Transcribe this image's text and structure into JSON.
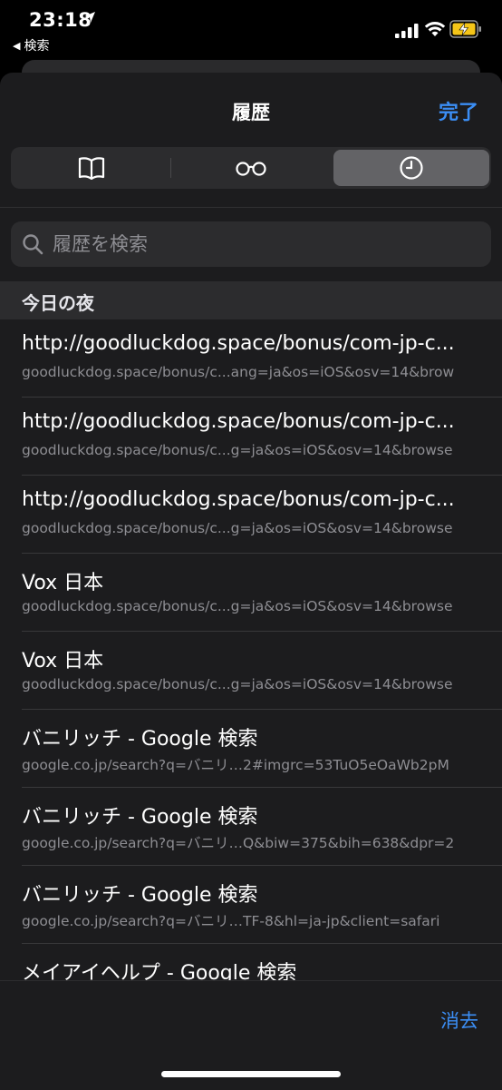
{
  "status": {
    "time": "23:18",
    "back_app": "検索"
  },
  "sheet": {
    "title": "履歴",
    "done_label": "完了",
    "tabs": [
      {
        "icon": "book-icon",
        "selected": false
      },
      {
        "icon": "reading-list-glasses-icon",
        "selected": false
      },
      {
        "icon": "history-clock-icon",
        "selected": true
      }
    ],
    "search_placeholder": "履歴を検索",
    "section_title": "今日の夜",
    "clear_label": "消去"
  },
  "history": [
    {
      "title": "http://goodluckdog.space/bonus/com-jp-c...",
      "url": "goodluckdog.space/bonus/c...ang=ja&os=iOS&osv=14&brow"
    },
    {
      "title": "http://goodluckdog.space/bonus/com-jp-c...",
      "url": "goodluckdog.space/bonus/c...g=ja&os=iOS&osv=14&browse"
    },
    {
      "title": "http://goodluckdog.space/bonus/com-jp-c...",
      "url": "goodluckdog.space/bonus/c...g=ja&os=iOS&osv=14&browse"
    },
    {
      "title": "Vox 日本",
      "url": "goodluckdog.space/bonus/c...g=ja&os=iOS&osv=14&browse"
    },
    {
      "title": "Vox 日本",
      "url": "goodluckdog.space/bonus/c...g=ja&os=iOS&osv=14&browse"
    },
    {
      "title": "バニリッチ - Google 検索",
      "url": "google.co.jp/search?q=バニリ…2#imgrc=53TuO5eOaWb2pM"
    },
    {
      "title": "バニリッチ - Google 検索",
      "url": "google.co.jp/search?q=バニリ…Q&biw=375&bih=638&dpr=2"
    },
    {
      "title": "バニリッチ - Google 検索",
      "url": "google.co.jp/search?q=バニリ…TF-8&hl=ja-jp&client=safari"
    },
    {
      "title": "メイアイヘルプ - Google 検索",
      "url": ""
    }
  ],
  "colors": {
    "accent": "#3b8ef5",
    "background": "#1c1c1e",
    "secondary_text": "#8e8e93"
  }
}
